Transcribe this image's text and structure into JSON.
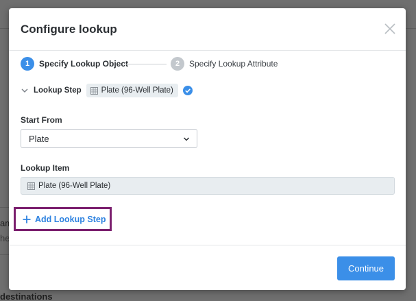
{
  "background": {
    "partial_texts": [
      "am",
      "hea",
      "destinations"
    ]
  },
  "modal": {
    "title": "Configure lookup",
    "close_icon": "close-icon"
  },
  "stepper": {
    "steps": [
      {
        "number": "1",
        "label": "Specify Lookup Object",
        "state": "active"
      },
      {
        "number": "2",
        "label": "Specify Lookup Attribute",
        "state": "inactive"
      }
    ]
  },
  "lookup_step": {
    "label": "Lookup Step",
    "chip_label": "Plate (96-Well Plate)",
    "icons": [
      "chevron-down-icon",
      "grid-icon",
      "check-circle-icon"
    ]
  },
  "start_from": {
    "label": "Start From",
    "value": "Plate"
  },
  "lookup_item": {
    "label": "Lookup Item",
    "value": "Plate (96-Well Plate)"
  },
  "add_lookup_step": {
    "label": "Add Lookup Step",
    "icon": "plus-icon"
  },
  "footer": {
    "continue_label": "Continue"
  },
  "colors": {
    "accent": "#3b8fe8",
    "highlight_border": "#7b1f6e",
    "chip_bg": "#e8edf0",
    "overlay": "#6f6f6f"
  }
}
